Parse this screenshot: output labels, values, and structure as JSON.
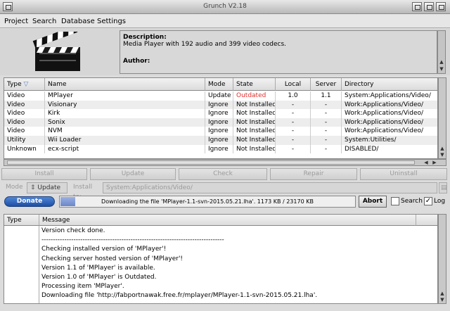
{
  "window": {
    "title": "Grunch V2.18"
  },
  "menu": [
    "Project",
    "Search",
    "Database",
    "Settings"
  ],
  "description": {
    "label": "Description:",
    "text": "Media Player with 192 audio and 399 video codecs.",
    "author_label": "Author:"
  },
  "table": {
    "headers": [
      "Type",
      "Name",
      "Mode",
      "State",
      "Local",
      "Server",
      "Directory"
    ],
    "rows": [
      [
        "Video",
        "MPlayer",
        "Update",
        "Outdated",
        "1.0",
        "1.1",
        "System:Applications/Video/"
      ],
      [
        "Video",
        "Visionary",
        "Ignore",
        "Not Installed",
        "-",
        "-",
        "Work:Applications/Video/"
      ],
      [
        "Video",
        "Kirk",
        "Ignore",
        "Not Installed",
        "-",
        "-",
        "Work:Applications/Video/"
      ],
      [
        "Video",
        "Sonix",
        "Ignore",
        "Not Installed",
        "-",
        "-",
        "Work:Applications/Video/"
      ],
      [
        "Video",
        "NVM",
        "Ignore",
        "Not Installed",
        "-",
        "-",
        "Work:Applications/Video/"
      ],
      [
        "Utility",
        "Wii Loader",
        "Ignore",
        "Not Installed",
        "-",
        "-",
        "System:Utilities/"
      ],
      [
        "Unknown",
        "ecx-script",
        "Ignore",
        "Not Installed",
        "-",
        "-",
        "DISABLED/"
      ]
    ]
  },
  "actions": [
    "Install",
    "Update",
    "Check",
    "Repair",
    "Uninstall"
  ],
  "moderow": {
    "mode_label": "Mode",
    "mode_value": "Update",
    "install_label": "Install to:",
    "install_path": "System:Applications/Video/"
  },
  "progress": {
    "donate_label": "Donate",
    "text": "Downloading the file 'MPlayer-1.1-svn-2015.05.21.lha'. 1173 KB / 23170 KB",
    "fraction": 0.05,
    "abort_label": "Abort",
    "search_label": "Search",
    "search_checked": false,
    "log_label": "Log",
    "log_checked": true
  },
  "log": {
    "headers": [
      "Type",
      "Message"
    ],
    "lines": [
      "Version check done.",
      "--------------------------------------------------------------------------------",
      "Checking installed version of 'MPlayer'!",
      "Checking server hosted version of 'MPlayer'!",
      "Version 1.1 of 'MPlayer' is available.",
      "Version 1.0 of 'MPlayer' is Outdated.",
      "Processing item 'MPlayer'.",
      "Downloading file 'http://fabportnawak.free.fr/mplayer/MPlayer-1.1-svn-2015.05.21.lha'."
    ]
  },
  "colors": {
    "outdated": "#e03030",
    "donate": "#2a5fb8"
  }
}
